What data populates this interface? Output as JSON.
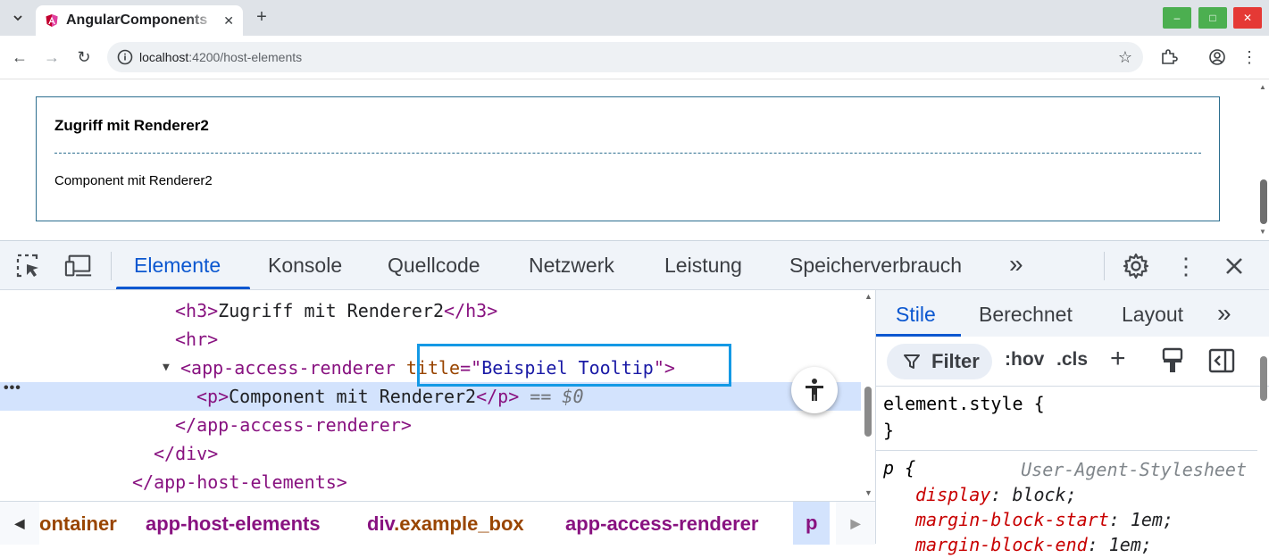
{
  "browser": {
    "tab_title": "AngularComponents",
    "url_host": "localhost",
    "url_path": ":4200/host-elements",
    "new_tab_symbol": "+",
    "window_buttons": {
      "minimize": "–",
      "maximize": "□",
      "close": "✕"
    }
  },
  "page": {
    "heading": "Zugriff mit Renderer2",
    "paragraph": "Component mit Renderer2"
  },
  "devtools": {
    "tabs": [
      "Elemente",
      "Konsole",
      "Quellcode",
      "Netzwerk",
      "Leistung",
      "Speicherverbrauch"
    ],
    "active_tab": "Elemente",
    "more_tabs": "»",
    "dom": {
      "line1_open": "<h3>",
      "line1_text": "Zugriff mit Renderer2",
      "line1_close": "</h3>",
      "line2": "<hr>",
      "line3_tag": "<app-access-renderer",
      "line3_attr": "title",
      "line3_eq": "=\"",
      "line3_val": "Beispiel Tooltip",
      "line3_end": "\">",
      "line4_open": "<p>",
      "line4_text": "Component mit Renderer2",
      "line4_close": "</p>",
      "line4_ref": " == $0",
      "line5": "</app-access-renderer>",
      "line6": "</div>",
      "line7": "</app-host-elements>",
      "row_menu": "•••"
    },
    "breadcrumbs": [
      {
        "tag": "",
        "cls": "ontainer"
      },
      {
        "tag": "app-host-elements",
        "cls": ""
      },
      {
        "tag": "div",
        "cls": ".example_box"
      },
      {
        "tag": "app-access-renderer",
        "cls": ""
      },
      {
        "tag": "p",
        "cls": ""
      }
    ],
    "styles": {
      "tabs": [
        "Stile",
        "Berechnet",
        "Layout"
      ],
      "filter_label": "Filter",
      "hov": ":hov",
      "cls": ".cls",
      "element_style_selector": "element.style {",
      "close_brace": "}",
      "p_selector": "p {",
      "ua_label": "User-Agent-Stylesheet",
      "declarations": [
        {
          "prop": "display",
          "val": "block;"
        },
        {
          "prop": "margin-block-start",
          "val": "1em;"
        },
        {
          "prop": "margin-block-end",
          "val": "1em;"
        }
      ]
    }
  }
}
